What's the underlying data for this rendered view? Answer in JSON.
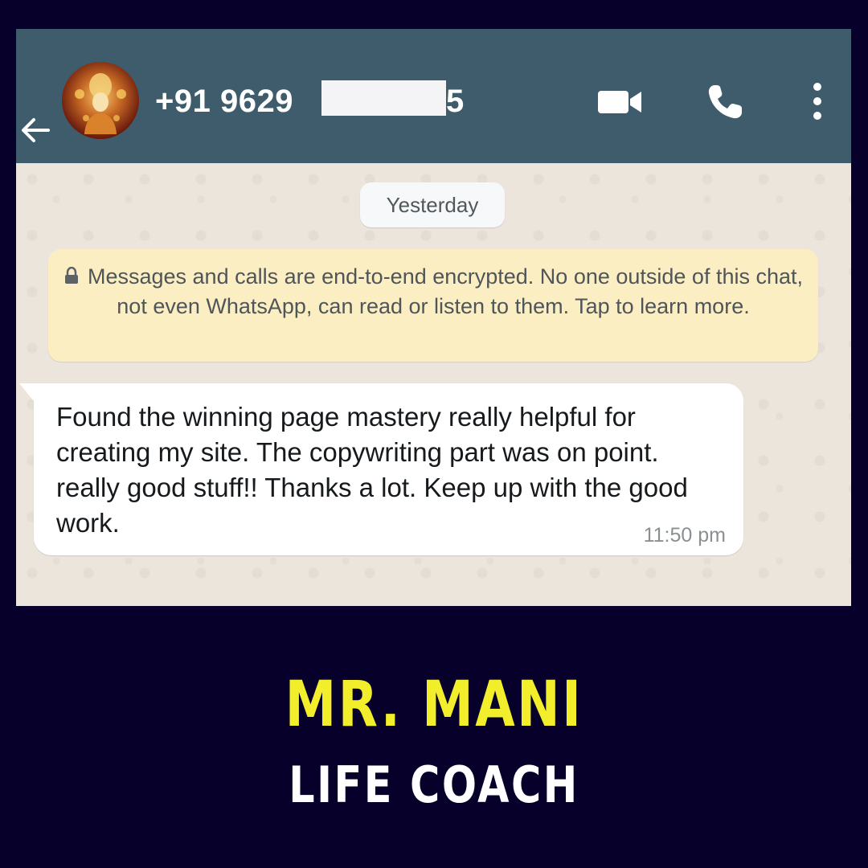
{
  "header": {
    "phone_prefix": "+91 9629",
    "phone_suffix": "5",
    "header_color": "#3e5c6b"
  },
  "chat": {
    "date_label": "Yesterday",
    "encryption_notice": "Messages and calls are end-to-end encrypted. No one outside of this chat, not even WhatsApp, can read or listen to them. Tap to learn more.",
    "message": {
      "text": "Found the winning page mastery really helpful for creating my site. The copywriting part was on point. really good stuff!! Thanks a lot. Keep up with the good work.",
      "time": "11:50 pm"
    }
  },
  "caption": {
    "name": "MR. MANI",
    "role": "LIFE COACH",
    "name_color": "#f3ee2b",
    "background_color": "#06002b"
  },
  "icons": [
    "back-arrow-icon",
    "video-call-icon",
    "phone-call-icon",
    "more-options-icon",
    "lock-icon"
  ]
}
